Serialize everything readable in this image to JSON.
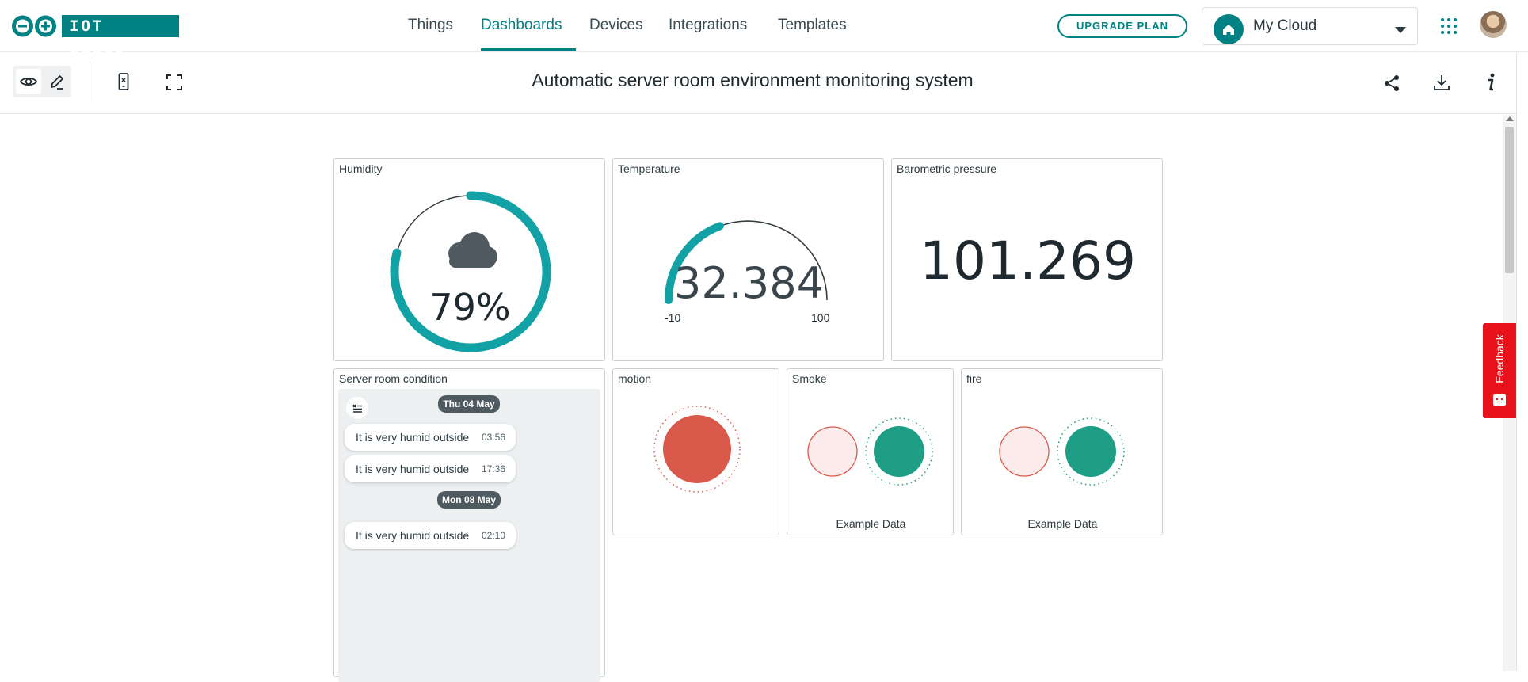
{
  "app": {
    "logo_text": "IOT CLOUD"
  },
  "nav": {
    "tabs": [
      "Things",
      "Dashboards",
      "Devices",
      "Integrations",
      "Templates"
    ],
    "active_tab": "Dashboards",
    "upgrade_label": "UPGRADE PLAN",
    "space_name": "My Cloud"
  },
  "dashboard": {
    "title": "Automatic server room environment monitoring system"
  },
  "widgets": {
    "humidity": {
      "title": "Humidity",
      "value": "79%",
      "percent": 79
    },
    "temperature": {
      "title": "Temperature",
      "value": "32.384",
      "min": "-10",
      "max": "100"
    },
    "pressure": {
      "title": "Barometric pressure",
      "value": "101.269"
    },
    "messenger": {
      "title": "Server room condition",
      "groups": [
        {
          "date": "Thu 04 May",
          "messages": [
            {
              "text": "It is very humid outside",
              "time": "03:56"
            },
            {
              "text": "It is very humid outside",
              "time": "17:36"
            }
          ]
        },
        {
          "date": "Mon 08 May",
          "messages": [
            {
              "text": "It is very humid outside",
              "time": "02:10"
            }
          ]
        }
      ]
    },
    "motion": {
      "title": "motion",
      "status_color": "#d95a4b"
    },
    "smoke": {
      "title": "Smoke",
      "caption": "Example Data",
      "on_color": "#1f9e86",
      "off_color": "#fbeceb"
    },
    "fire": {
      "title": "fire",
      "caption": "Example Data",
      "on_color": "#1f9e86",
      "off_color": "#fbeceb"
    }
  },
  "feedback": {
    "label": "Feedback"
  },
  "colors": {
    "accent": "#008184",
    "gauge": "#12a1a5",
    "feedback": "#e8121a"
  }
}
